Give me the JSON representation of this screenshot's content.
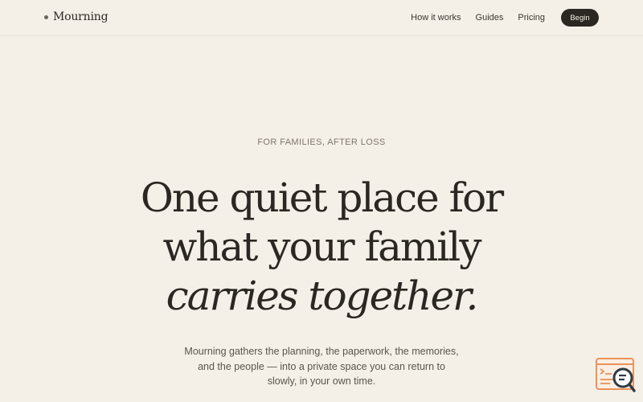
{
  "brand": {
    "name": "Mourning"
  },
  "nav": {
    "links": [
      "How it works",
      "Guides",
      "Pricing"
    ],
    "cta_label": "Begin"
  },
  "hero": {
    "eyebrow": "FOR FAMILIES, AFTER LOSS",
    "headline_line1": "One quiet place for",
    "headline_line2": "what your family",
    "headline_line3": "carries together.",
    "lede_line1": "Mourning gathers the planning, the paperwork, the memories,",
    "lede_line2": "and the people — into a private space you can return to",
    "lede_line3": "slowly, in your own time."
  },
  "colors": {
    "background": "#f5f0e7",
    "ink": "#2b2722",
    "muted": "#7d756b",
    "widget_accent": "#e9935a",
    "widget_dark": "#2f3a44"
  },
  "icons": {
    "help_widget": "chat-search-icon"
  }
}
